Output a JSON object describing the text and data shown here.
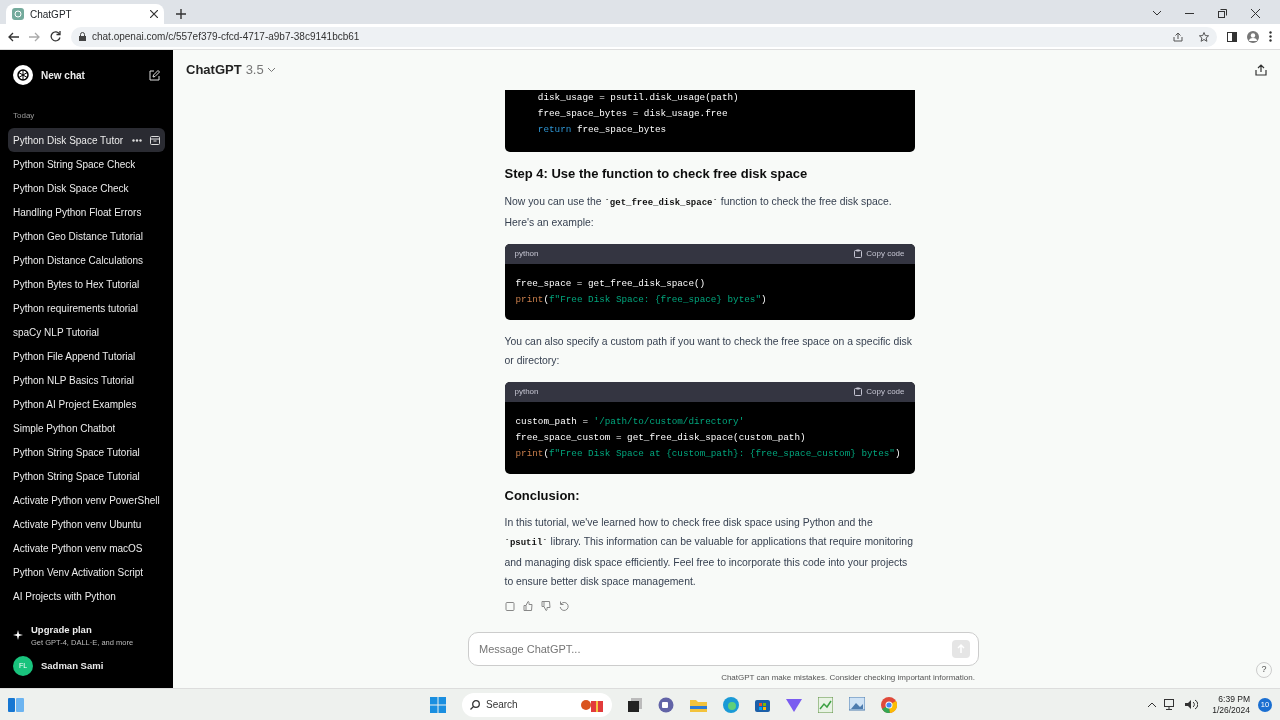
{
  "browser": {
    "tab": {
      "title": "ChatGPT"
    },
    "url": "chat.openai.com/c/557ef379-cfcd-4717-a9b7-38c9141bcb61"
  },
  "sidebar": {
    "new_chat": "New chat",
    "section": "Today",
    "items": [
      {
        "label": "Python Disk Space Tutor",
        "selected": true
      },
      {
        "label": "Python String Space Check",
        "selected": false
      },
      {
        "label": "Python Disk Space Check",
        "selected": false
      },
      {
        "label": "Handling Python Float Errors",
        "selected": false
      },
      {
        "label": "Python Geo Distance Tutorial",
        "selected": false
      },
      {
        "label": "Python Distance Calculations",
        "selected": false
      },
      {
        "label": "Python Bytes to Hex Tutorial",
        "selected": false
      },
      {
        "label": "Python requirements tutorial",
        "selected": false
      },
      {
        "label": "spaCy NLP Tutorial",
        "selected": false
      },
      {
        "label": "Python File Append Tutorial",
        "selected": false
      },
      {
        "label": "Python NLP Basics Tutorial",
        "selected": false
      },
      {
        "label": "Python AI Project Examples",
        "selected": false
      },
      {
        "label": "Simple Python Chatbot",
        "selected": false
      },
      {
        "label": "Python String Space Tutorial",
        "selected": false
      },
      {
        "label": "Python String Space Tutorial",
        "selected": false
      },
      {
        "label": "Activate Python venv PowerShell",
        "selected": false
      },
      {
        "label": "Activate Python venv Ubuntu",
        "selected": false
      },
      {
        "label": "Activate Python venv macOS",
        "selected": false
      },
      {
        "label": "Python Venv Activation Script",
        "selected": false
      },
      {
        "label": "AI Projects with Python",
        "selected": false
      }
    ],
    "upgrade": {
      "title": "Upgrade plan",
      "subtitle": "Get GPT-4, DALL·E, and more"
    },
    "user": {
      "initials": "FL",
      "name": "Sadman Sami"
    }
  },
  "header": {
    "title": "ChatGPT",
    "version": "3.5"
  },
  "messages": [
    {
      "kind": "code",
      "lines": [
        [
          {
            "kind": "plain",
            "text": "    disk_usage = psutil.disk_usage(path)"
          }
        ],
        [
          {
            "kind": "plain",
            "text": "    free_space_bytes = disk_usage.free"
          }
        ],
        [
          {
            "kind": "keyword",
            "text": "    return"
          },
          {
            "kind": "plain",
            "text": " free_space_bytes"
          }
        ]
      ]
    },
    {
      "kind": "heading",
      "text": "Step 4: Use the function to check free disk space"
    },
    {
      "kind": "paragraph",
      "parts": [
        {
          "kind": "text",
          "text": "Now you can use the "
        },
        {
          "kind": "code",
          "text": "`get_free_disk_space`"
        },
        {
          "kind": "text",
          "text": " function to check the free disk space. Here's an example:"
        }
      ]
    },
    {
      "kind": "code",
      "language": "python",
      "copy_label": "Copy code",
      "lines": [
        [
          {
            "kind": "plain",
            "text": "free_space = get_free_disk_space()"
          }
        ],
        [
          {
            "kind": "builtin",
            "text": "print"
          },
          {
            "kind": "plain",
            "text": "("
          },
          {
            "kind": "string",
            "text": "f\"Free Disk Space: {free_space} bytes\""
          },
          {
            "kind": "plain",
            "text": ")"
          }
        ]
      ]
    },
    {
      "kind": "paragraph",
      "parts": [
        {
          "kind": "text",
          "text": "You can also specify a custom path if you want to check the free space on a specific disk or directory:"
        }
      ]
    },
    {
      "kind": "code",
      "language": "python",
      "copy_label": "Copy code",
      "lines": [
        [
          {
            "kind": "plain",
            "text": "custom_path = "
          },
          {
            "kind": "string",
            "text": "'/path/to/custom/directory'"
          }
        ],
        [
          {
            "kind": "plain",
            "text": "free_space_custom = get_free_disk_space(custom_path)"
          }
        ],
        [
          {
            "kind": "builtin",
            "text": "print"
          },
          {
            "kind": "plain",
            "text": "("
          },
          {
            "kind": "string",
            "text": "f\"Free Disk Space at {custom_path}: {free_space_custom} bytes\""
          },
          {
            "kind": "plain",
            "text": ")"
          }
        ]
      ]
    },
    {
      "kind": "heading",
      "text": "Conclusion:"
    },
    {
      "kind": "paragraph",
      "parts": [
        {
          "kind": "text",
          "text": "In this tutorial, we've learned how to check free disk space using Python and the "
        },
        {
          "kind": "code",
          "text": "`psutil`"
        },
        {
          "kind": "text",
          "text": " library. This information can be valuable for applications that require monitoring and managing disk space efficiently. Feel free to incorporate this code into your projects to ensure better disk space management."
        }
      ]
    }
  ],
  "composer": {
    "placeholder": "Message ChatGPT..."
  },
  "disclaimer": "ChatGPT can make mistakes. Consider checking important information.",
  "help": "?",
  "taskbar": {
    "search": "Search",
    "time": "6:39 PM",
    "date": "1/26/2024",
    "notifications": "10"
  }
}
